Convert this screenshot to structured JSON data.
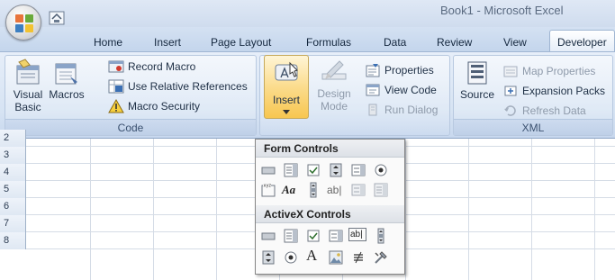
{
  "window": {
    "title": "Book1 - Microsoft Excel"
  },
  "tabs": [
    {
      "label": "Home"
    },
    {
      "label": "Insert"
    },
    {
      "label": "Page Layout"
    },
    {
      "label": "Formulas"
    },
    {
      "label": "Data"
    },
    {
      "label": "Review"
    },
    {
      "label": "View"
    },
    {
      "label": "Developer",
      "active": true
    }
  ],
  "ribbon": {
    "code": {
      "label": "Code",
      "visual_basic": [
        "Visual",
        "Basic"
      ],
      "macros": "Macros",
      "record_macro": "Record Macro",
      "relative_refs": "Use Relative References",
      "macro_security": "Macro Security"
    },
    "controls": {
      "insert": "Insert",
      "design_mode": [
        "Design",
        "Mode"
      ],
      "properties": "Properties",
      "view_code": "View Code",
      "run_dialog": "Run Dialog"
    },
    "xml": {
      "label": "XML",
      "source": "Source",
      "map_properties": "Map Properties",
      "expansion_packs": "Expansion Packs",
      "refresh_data": "Refresh Data"
    }
  },
  "sheet": {
    "row_numbers": [
      "2",
      "3",
      "4",
      "5",
      "6",
      "7",
      "8"
    ]
  },
  "insert_menu": {
    "form_controls": {
      "header": "Form Controls",
      "row1": [
        "button-icon",
        "combo-box-icon",
        "check-box-icon",
        "spin-button-icon",
        "list-box-icon",
        "option-button-icon"
      ],
      "row2": [
        "group-box-icon",
        "label-icon",
        "scroll-bar-icon",
        "text-field-icon",
        "combo-list-edit-icon",
        "combo-dropdown-edit-icon"
      ],
      "label_glyph": "Aa",
      "text_field_glyph": "ab|"
    },
    "activex_controls": {
      "header": "ActiveX Controls",
      "row1": [
        "command-button-icon",
        "combo-box-icon",
        "check-box-icon",
        "list-box-icon",
        "text-box-icon",
        "scroll-bar-icon"
      ],
      "row2": [
        "spin-button-icon",
        "option-button-icon",
        "label-icon",
        "image-icon",
        "toggle-button-icon",
        "more-controls-icon"
      ],
      "text_box_glyph": "ab|",
      "label_glyph": "A"
    }
  }
}
